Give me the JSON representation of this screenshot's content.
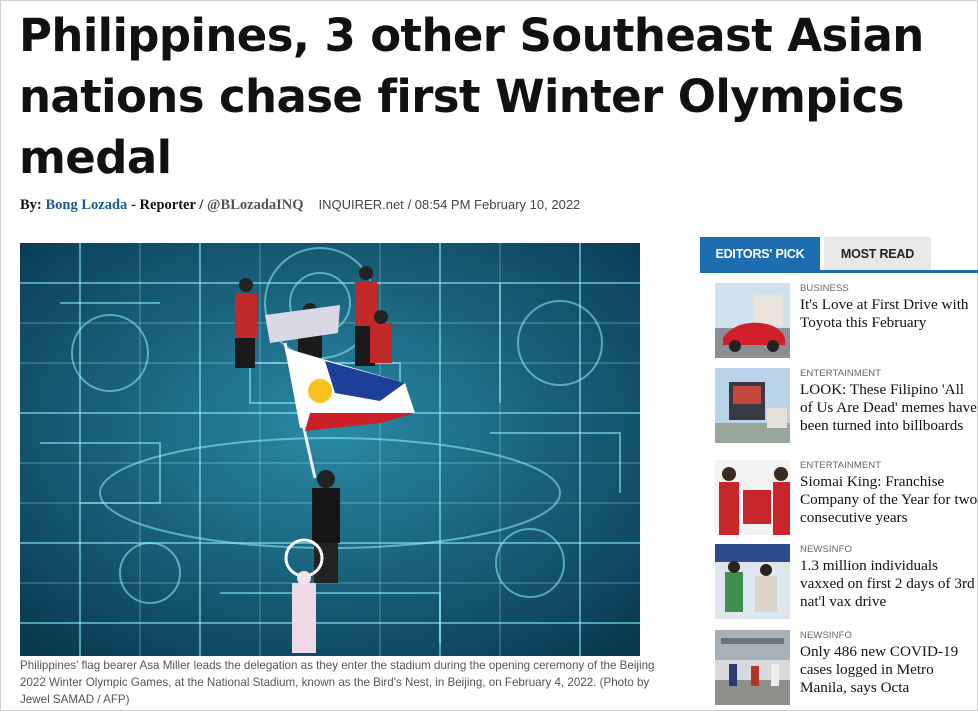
{
  "article": {
    "headline": "Philippines, 3 other Southeast Asian nations chase first Winter Olympics medal",
    "byline": {
      "prefix": "By:",
      "author": "Bong Lozada",
      "role": "- Reporter /",
      "handle": "@BLozadaINQ",
      "source": "INQUIRER.net",
      "datetime": "/ 08:54 PM February 10, 2022"
    },
    "photo_caption": "Philippines' flag bearer Asa Miller leads the delegation as they enter the stadium during the opening ceremony of the Beijing 2022 Winter Olympic Games, at the National Stadium, known as the Bird's Nest, in Beijing, on February 4, 2022. (Photo by Jewel SAMAD / AFP)"
  },
  "sidebar": {
    "tabs": [
      "EDITORS' PICK",
      "MOST READ"
    ],
    "active_tab": "EDITORS' PICK",
    "stories": [
      {
        "category": "BUSINESS",
        "title": "It's Love at First Drive with Toyota this February"
      },
      {
        "category": "ENTERTAINMENT",
        "title": "LOOK: These Filipino 'All of Us Are Dead' memes have been turned into billboards"
      },
      {
        "category": "ENTERTAINMENT",
        "title": "Siomai King: Franchise Company of the Year for two consecutive years"
      },
      {
        "category": "NEWSINFO",
        "title": "1.3 million individuals vaxxed on first 2 days of 3rd nat'l vax drive"
      },
      {
        "category": "NEWSINFO",
        "title": "Only 486 new COVID-19 cases logged in Metro Manila, says Octa"
      }
    ]
  },
  "colors": {
    "accent": "#1b6db0",
    "author_link": "#1a5a96",
    "tab_inactive": "#e8e8e8"
  }
}
